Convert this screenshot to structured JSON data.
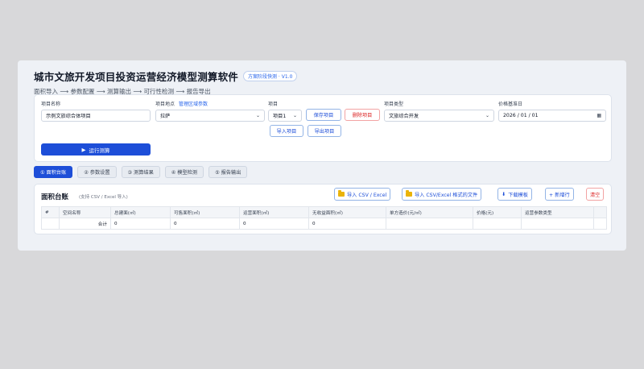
{
  "app": {
    "title": "城市文旅开发项目投资运营经济模型测算软件",
    "version": "方案阶段快测 · V1.0",
    "subtitle": "面积导入 ⟶ 参数配置 ⟶ 测算输出 ⟶ 可行性检测 ⟶ 报告导出"
  },
  "form": {
    "project_name": {
      "label": "项目名称",
      "value": "示例文旅综合体项目"
    },
    "location": {
      "label": "项目地点",
      "link": "管理区域参数",
      "value": "拉萨"
    },
    "project": {
      "label": "项目",
      "value": "项目1"
    },
    "project_type": {
      "label": "项目类型",
      "value": "文旅综合开发"
    },
    "base_date": {
      "label": "价格基准日",
      "value": "2026 / 01 / 01"
    },
    "buttons": {
      "save": "保存项目",
      "delete": "删除项目",
      "import": "导入项目",
      "export": "导出项目",
      "run": "运行测算"
    }
  },
  "tabs": [
    {
      "label": "① 面积台账",
      "active": true
    },
    {
      "label": "② 参数设置",
      "active": false
    },
    {
      "label": "③ 测算结果",
      "active": false
    },
    {
      "label": "④ 模型检测",
      "active": false
    },
    {
      "label": "⑤ 报告输出",
      "active": false
    }
  ],
  "area_table": {
    "title": "面积台账",
    "hint": "(支持 CSV / Excel 导入)",
    "buttons": {
      "import_csv": "导入 CSV / Excel",
      "import_csv_format": "导入 CSV/Excel 格式的文件",
      "download_template": "下载模板",
      "add_row": "+ 新增行",
      "clear": "清空"
    },
    "columns": [
      "#",
      "空间名称",
      "总建面(㎡)",
      "可售面积(㎡)",
      "运营面积(㎡)",
      "无收益面积(㎡)",
      "单方造价(元/㎡)",
      "价格(元)",
      "运营参数类型",
      ""
    ],
    "total_row": {
      "label": "合计",
      "gross": "0",
      "sellable": "0",
      "operating": "0",
      "non_income": "0"
    }
  }
}
